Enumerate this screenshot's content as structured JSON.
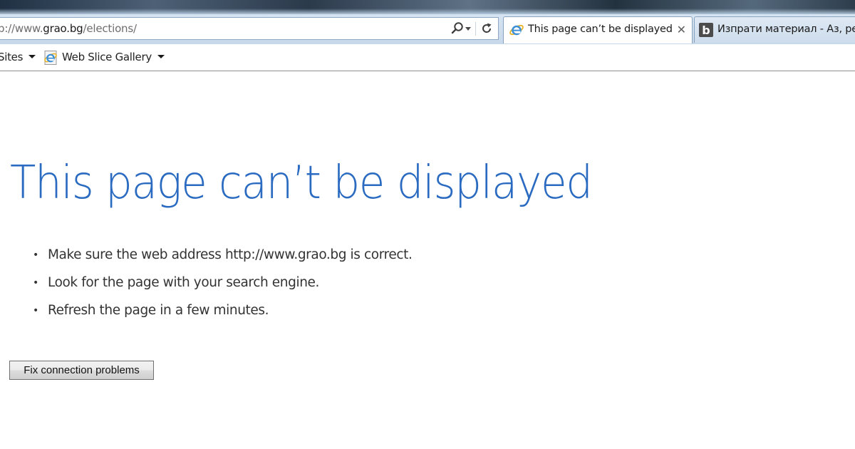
{
  "browser": {
    "address_bar": {
      "url_prefix": "p://www.",
      "url_host": "grao.bg",
      "url_path": "/elections/",
      "icons": [
        "search-icon",
        "dropdown-arrow-icon",
        "refresh-icon"
      ]
    },
    "tabs": [
      {
        "title": "This page can’t be displayed",
        "active": true,
        "favicon": "ie-icon",
        "close_label": "✕"
      },
      {
        "title": "Изпрати материал - Аз, ре",
        "active": false,
        "favicon": "b-site-icon"
      }
    ],
    "favorites_bar": {
      "items": [
        {
          "label": "Sites",
          "has_dropdown": true
        },
        {
          "label": "Web Slice Gallery",
          "has_dropdown": true,
          "icon": "ie-icon"
        }
      ]
    }
  },
  "page": {
    "title": "This page can’t be displayed",
    "tips": [
      "Make sure the web address http://www.grao.bg is correct.",
      "Look for the page with your search engine.",
      "Refresh the page in a few minutes."
    ],
    "bullet": "•",
    "fix_button_label": "Fix connection problems"
  },
  "colors": {
    "title_blue": "#2a6bc1",
    "tab_border": "#8aa3bd",
    "nav_background": "#c6d8ea"
  }
}
